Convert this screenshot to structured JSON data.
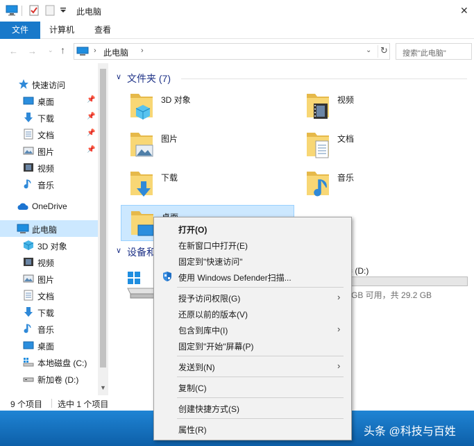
{
  "window": {
    "title": "此电脑",
    "close_glyph": "✕"
  },
  "ribbon": {
    "tabs": [
      "文件",
      "计算机",
      "查看"
    ]
  },
  "address": {
    "path": "此电脑",
    "search_placeholder": "搜索\"此电脑\""
  },
  "sidebar": {
    "quick_access": "快速访问",
    "quick_items": [
      "桌面",
      "下载",
      "文档",
      "图片",
      "视频",
      "音乐"
    ],
    "onedrive": "OneDrive",
    "this_pc": "此电脑",
    "pc_items": [
      "3D 对象",
      "视频",
      "图片",
      "文档",
      "下载",
      "音乐",
      "桌面",
      "本地磁盘 (C:)",
      "新加卷 (D:)"
    ]
  },
  "content": {
    "folders_header": "文件夹 (7)",
    "devices_header": "设备和",
    "folders": [
      "3D 对象",
      "视频",
      "图片",
      "文档",
      "下载",
      "音乐",
      "桌面"
    ],
    "drive_label": "卷 (D:)",
    "drive_free": "2 GB 可用，共 29.2 GB",
    "drive_used_fraction": 0
  },
  "status": {
    "count": "9 个项目",
    "selected": "选中 1 个项目"
  },
  "taskbar": {
    "watermark": "头条 @科技与百姓"
  },
  "context_menu": {
    "items": [
      "打开(O)",
      "在新窗口中打开(E)",
      "固定到\"快速访问\"",
      "使用 Windows Defender扫描...",
      "授予访问权限(G)",
      "还原以前的版本(V)",
      "包含到库中(I)",
      "固定到\"开始\"屏幕(P)",
      "发送到(N)",
      "复制(C)",
      "创建快捷方式(S)",
      "属性(R)"
    ]
  },
  "colors": {
    "accent": "#1979ca",
    "selection": "#cce8ff",
    "header_blue": "#1e3287",
    "folder_yellow": "#f8d775",
    "taskbar": "#0d5fa8"
  }
}
